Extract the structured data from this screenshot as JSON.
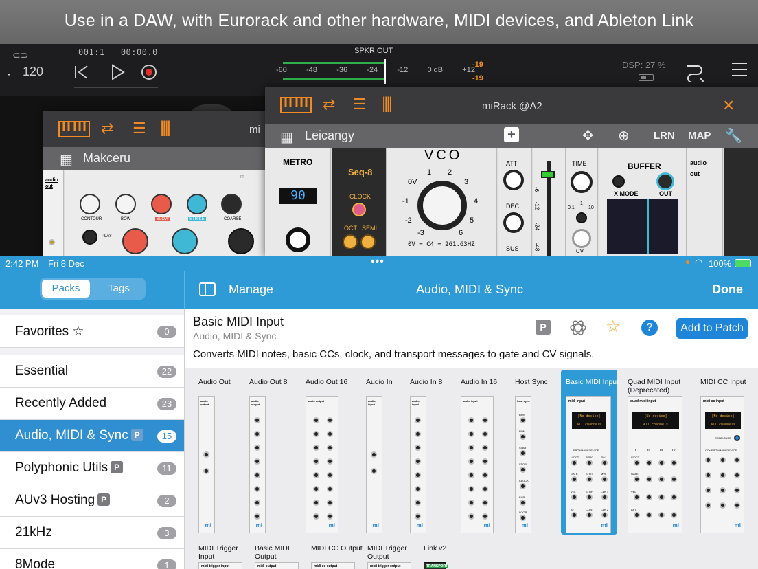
{
  "banner": {
    "text": "Use in a DAW, with Eurorack and other hardware, MIDI devices, and Ableton Link"
  },
  "host": {
    "tempo": "♩ 120",
    "position": "001:1",
    "time": "00:00.0",
    "output_label": "SPKR OUT",
    "meter_ticks": [
      "-60",
      "-48",
      "-36",
      "-24",
      "-12",
      "0 dB",
      "+12"
    ],
    "peak_left": "-19",
    "peak_right": "-19",
    "dsp": "DSP: 27 %"
  },
  "rack_front": {
    "title": "miRack @A2",
    "preset": "Leicangy",
    "buttons": {
      "learn": "LRN",
      "map": "MAP"
    },
    "modules": {
      "metro": {
        "name": "METRO",
        "display": "90"
      },
      "seq": {
        "name": "Seq-8",
        "clock": "CLOCK",
        "oct": "OCT",
        "semi": "SEMI"
      },
      "vco": {
        "name": "VCO",
        "scale": [
          "0V",
          "1",
          "2",
          "3",
          "-1",
          "4",
          "-2",
          "5",
          "-3",
          "6"
        ],
        "footer": "0V = C4 = 261.63HZ"
      },
      "adsr": {
        "att": "ATT",
        "dec": "DEC",
        "sus": "SUS",
        "marks": [
          "-6",
          "-12",
          "-24",
          "-48"
        ]
      },
      "timer": {
        "time": "TIME",
        "scale": [
          "0.1",
          "1",
          "10"
        ],
        "cv": "CV"
      },
      "buffer": {
        "name": "BUFFER",
        "mode": "X MODE",
        "out": "OUT"
      },
      "audio_out": {
        "name": "audio out"
      }
    }
  },
  "rack_back": {
    "title": "mi",
    "preset": "Makceru",
    "labels": [
      "CONTOUR",
      "BOW",
      "BLOW",
      "STRIKE",
      "COARSE",
      "PLAY"
    ],
    "audio_out": "audio out",
    "header_label": "m"
  },
  "statusbar": {
    "time": "2:42 PM",
    "date": "Fri 8 Dec",
    "battery": "100%"
  },
  "nav": {
    "tab_packs": "Packs",
    "tab_tags": "Tags",
    "manage": "Manage",
    "title": "Audio, MIDI & Sync",
    "done": "Done"
  },
  "sidebar": {
    "items": [
      {
        "label": "Favorites ☆",
        "count": "0",
        "pro": ""
      },
      {
        "label": "Essential",
        "count": "22",
        "pro": ""
      },
      {
        "label": "Recently Added",
        "count": "23",
        "pro": ""
      },
      {
        "label": "Audio, MIDI & Sync",
        "count": "15",
        "pro": "P"
      },
      {
        "label": "Polyphonic Utils",
        "count": "11",
        "pro": "P"
      },
      {
        "label": "AUv3 Hosting",
        "count": "2",
        "pro": "P"
      },
      {
        "label": "21kHz",
        "count": "3",
        "pro": ""
      },
      {
        "label": "8Mode",
        "count": "1",
        "pro": ""
      }
    ]
  },
  "detail": {
    "title": "Basic MIDI Input",
    "subtitle": "Audio, MIDI & Sync",
    "pro_badge": "P",
    "description": "Converts MIDI notes, basic CCs, clock, and transport messages to gate and CV signals.",
    "add_label": "Add to Patch",
    "help_icon_label": "?",
    "modules": [
      {
        "name": "Audio Out",
        "panel_label": "audio output",
        "brand": "mi"
      },
      {
        "name": "Audio Out 8",
        "panel_label": "audio output",
        "brand": "mi"
      },
      {
        "name": "Audio Out 16",
        "panel_label": "audio output",
        "brand": "mi"
      },
      {
        "name": "Audio In",
        "panel_label": "audio input",
        "brand": "mi"
      },
      {
        "name": "Audio In 8",
        "panel_label": "audio input",
        "brand": "mi"
      },
      {
        "name": "Audio In 16",
        "panel_label": "audio input",
        "brand": "mi"
      },
      {
        "name": "Host Sync",
        "panel_label": "host sync",
        "brand": "mi"
      },
      {
        "name": "Basic MIDI Input",
        "panel_label": "midi input",
        "brand": "mi"
      },
      {
        "name": "Quad MIDI Input (Deprecated)",
        "panel_label": "quad midi input",
        "brand": "mi"
      },
      {
        "name": "MIDI CC Input",
        "panel_label": "midi cc input",
        "brand": "mi"
      },
      {
        "name": "MIDI Trigger Input",
        "panel_label": "midi trigger input",
        "brand": ""
      },
      {
        "name": "Basic MIDI Output",
        "panel_label": "midi output",
        "brand": ""
      },
      {
        "name": "MIDI CC Output",
        "panel_label": "midi cc output",
        "brand": ""
      },
      {
        "name": "MIDI Trigger Output",
        "panel_label": "midi trigger output",
        "brand": ""
      },
      {
        "name": "Link v2",
        "panel_label": "TRANSPORT",
        "brand": ""
      }
    ],
    "lcd_device": "[No device]",
    "lcd_channels": "All channels",
    "from_device": "FROM MIDI DEVICE",
    "configure": "CONFIGURE",
    "ccs_from_device": "CCs FROM MIDI DEVICE",
    "midi_labels": [
      "V/OCT",
      "RTRG",
      "PW",
      "GATE",
      "STRT",
      "MW",
      "VEL",
      "STOP",
      "CLK 1",
      "AFT",
      "CONT",
      "CLK 2"
    ],
    "hostsync_labels": [
      "BPM",
      "RUN",
      "START",
      "STOP",
      "CLOCK",
      "BAR",
      "LOOP"
    ],
    "quad_channels": [
      "I",
      "II",
      "III",
      "IV"
    ],
    "quad_rows": [
      "V/OCT",
      "GATE",
      "VEL",
      "AFT"
    ]
  },
  "colors": {
    "accent": "#2f9bd6",
    "button": "#1f85d8",
    "orange": "#f08a24",
    "star": "#f5a623"
  }
}
